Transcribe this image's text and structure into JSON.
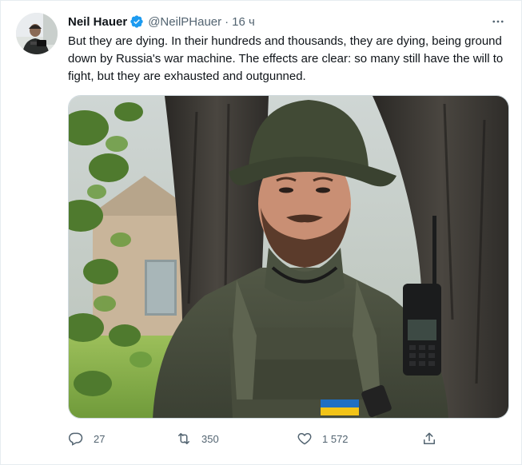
{
  "author": {
    "name": "Neil Hauer",
    "handle": "@NeilPHauer",
    "separator": "·",
    "time": "16 ч",
    "verified": true
  },
  "tweet_text": "But they are dying. In their hundreds and thousands, they are dying, being ground down by Russia's war machine. The effects are clear: so many still have the will to fight, but they are exhausted and outgunned.",
  "media": {
    "alt": "Photo of a soldier in a green bucket hat and body armor with a radio, standing in front of a tree trunk"
  },
  "actions": {
    "reply_count": "27",
    "retweet_count": "350",
    "like_count": "1 572"
  },
  "icons": {
    "verified": "verified-badge-icon",
    "more": "more-options-icon",
    "reply": "reply-icon",
    "retweet": "retweet-icon",
    "like": "heart-icon",
    "share": "share-icon"
  },
  "colors": {
    "verified": "#1d9bf0",
    "secondary_text": "#536471",
    "primary_text": "#0f1419"
  }
}
